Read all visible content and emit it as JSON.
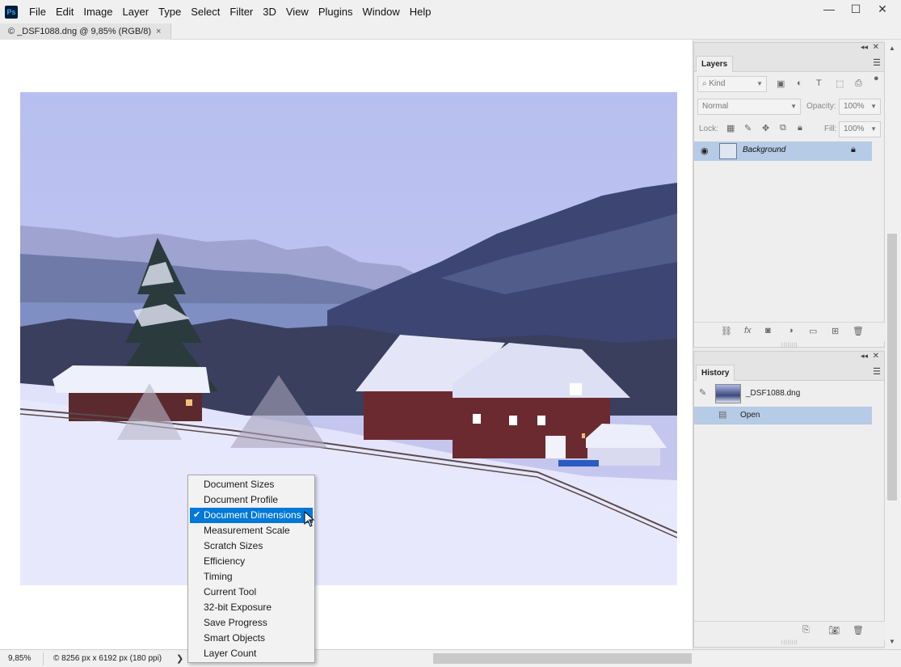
{
  "app": {
    "logo": "Ps"
  },
  "menu": [
    "File",
    "Edit",
    "Image",
    "Layer",
    "Type",
    "Select",
    "Filter",
    "3D",
    "View",
    "Plugins",
    "Window",
    "Help"
  ],
  "window_controls": {
    "minimize": "—",
    "maximize": "☐",
    "close": "✕"
  },
  "document_tab": {
    "title": "© _DSF1088.dng @ 9,85% (RGB/8)",
    "close": "×"
  },
  "layers_panel": {
    "tab": "Layers",
    "kind_placeholder": "Kind",
    "blend_mode": "Normal",
    "opacity_label": "Opacity:",
    "opacity_value": "100%",
    "lock_label": "Lock:",
    "fill_label": "Fill:",
    "fill_value": "100%",
    "layers": [
      {
        "name": "Background",
        "visible": true,
        "locked": true
      }
    ]
  },
  "history_panel": {
    "tab": "History",
    "snapshot": "_DSF1088.dng",
    "states": [
      "Open"
    ]
  },
  "status_bar": {
    "zoom": "9,85%",
    "info": "© 8256 px x 6192 px (180 ppi)",
    "arrow": "❯"
  },
  "context_menu": {
    "items": [
      "Document Sizes",
      "Document Profile",
      "Document Dimensions",
      "Measurement Scale",
      "Scratch Sizes",
      "Efficiency",
      "Timing",
      "Current Tool",
      "32-bit Exposure",
      "Save Progress",
      "Smart Objects",
      "Layer Count"
    ],
    "checked": "Document Dimensions"
  },
  "colors": {
    "selection": "#0078d7",
    "layer_highlight": "#b5cbe6",
    "ps_blue": "#31a8ff"
  }
}
